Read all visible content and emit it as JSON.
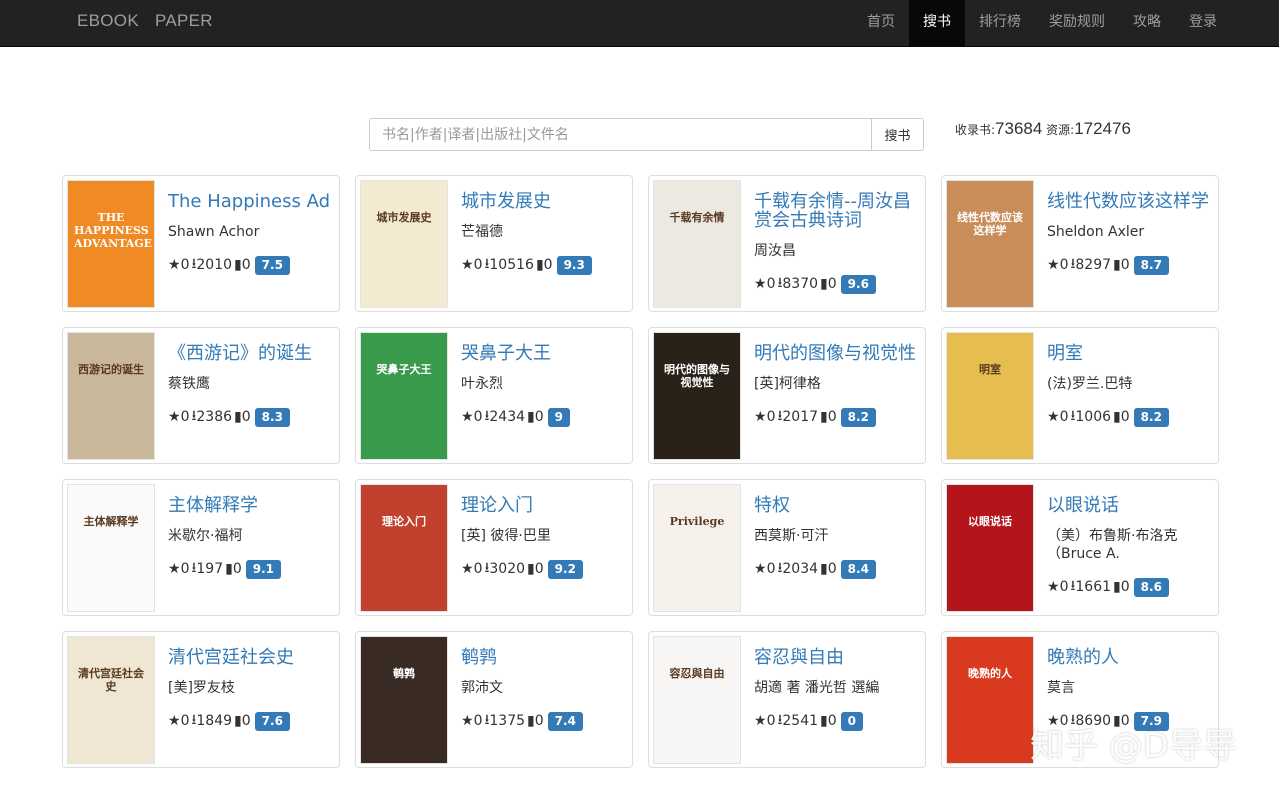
{
  "brand": {
    "word1": "EBOOK",
    "word2": "PAPER"
  },
  "nav": [
    {
      "label": "首页",
      "active": false
    },
    {
      "label": "搜书",
      "active": true
    },
    {
      "label": "排行榜",
      "active": false
    },
    {
      "label": "奖励规则",
      "active": false
    },
    {
      "label": "攻略",
      "active": false
    },
    {
      "label": "登录",
      "active": false
    }
  ],
  "search": {
    "placeholder": "书名|作者|译者|出版社|文件名",
    "value": "",
    "button": "搜书"
  },
  "stats": {
    "books_label": "收录书:",
    "books": "73684",
    "resources_label": "资源:",
    "resources": "172476"
  },
  "icons": {
    "star": "★",
    "download": "⭳",
    "comment": "▮"
  },
  "books": [
    {
      "title": "The Happiness Ad",
      "author": "Shawn Achor",
      "stars": "0",
      "downloads": "2010",
      "comments": "0",
      "score": "7.5",
      "cover_color": "#f08a24",
      "cover_text": "THE HAPPINESS ADVANTAGE"
    },
    {
      "title": "城市发展史",
      "author": "芒福德",
      "stars": "0",
      "downloads": "10516",
      "comments": "0",
      "score": "9.3",
      "cover_color": "#f3ead2",
      "cover_text": "城市发展史"
    },
    {
      "title": "千载有余情--周汝昌赏会古典诗词",
      "author": "周汝昌",
      "stars": "0",
      "downloads": "8370",
      "comments": "0",
      "score": "9.6",
      "cover_color": "#ece9e1",
      "cover_text": "千载有余情"
    },
    {
      "title": "线性代数应该这样学",
      "author": "Sheldon Axler",
      "stars": "0",
      "downloads": "8297",
      "comments": "0",
      "score": "8.7",
      "cover_color": "#c98d5a",
      "cover_text": "线性代数应该这样学"
    },
    {
      "title": "《西游记》的诞生",
      "author": "蔡铁鹰",
      "stars": "0",
      "downloads": "2386",
      "comments": "0",
      "score": "8.3",
      "cover_color": "#c9b79a",
      "cover_text": "西游记的诞生"
    },
    {
      "title": "哭鼻子大王",
      "author": "叶永烈",
      "stars": "0",
      "downloads": "2434",
      "comments": "0",
      "score": "9",
      "cover_color": "#3a9a4b",
      "cover_text": "哭鼻子大王"
    },
    {
      "title": "明代的图像与视觉性",
      "author": "[英]柯律格",
      "stars": "0",
      "downloads": "2017",
      "comments": "0",
      "score": "8.2",
      "cover_color": "#2a2119",
      "cover_text": "明代的图像与视觉性"
    },
    {
      "title": "明室",
      "author": "(法)罗兰.巴特",
      "stars": "0",
      "downloads": "1006",
      "comments": "0",
      "score": "8.2",
      "cover_color": "#e6bd4f",
      "cover_text": "明室"
    },
    {
      "title": "主体解释学",
      "author": "米歇尔·福柯",
      "stars": "0",
      "downloads": "197",
      "comments": "0",
      "score": "9.1",
      "cover_color": "#fafafa",
      "cover_text": "主体解释学"
    },
    {
      "title": "理论入门",
      "author": "[英] 彼得·巴里",
      "stars": "0",
      "downloads": "3020",
      "comments": "0",
      "score": "9.2",
      "cover_color": "#c2402e",
      "cover_text": "理论入门"
    },
    {
      "title": "特权",
      "author": "西莫斯·可汗",
      "stars": "0",
      "downloads": "2034",
      "comments": "0",
      "score": "8.4",
      "cover_color": "#f6f1ea",
      "cover_text": "Privilege"
    },
    {
      "title": "以眼说话",
      "author": "（美）布鲁斯·布洛克（Bruce A.",
      "stars": "0",
      "downloads": "1661",
      "comments": "0",
      "score": "8.6",
      "cover_color": "#b3151b",
      "cover_text": "以眼说话"
    },
    {
      "title": "清代宫廷社会史",
      "author": "[美]罗友枝",
      "stars": "0",
      "downloads": "1849",
      "comments": "0",
      "score": "7.6",
      "cover_color": "#efe6d3",
      "cover_text": "清代宫廷社会史"
    },
    {
      "title": "鹌鹑",
      "author": "郭沛文",
      "stars": "0",
      "downloads": "1375",
      "comments": "0",
      "score": "7.4",
      "cover_color": "#3a2a24",
      "cover_text": "鹌鹑"
    },
    {
      "title": "容忍與自由",
      "author": "胡適 著 潘光哲 選編",
      "stars": "0",
      "downloads": "2541",
      "comments": "0",
      "score": "0",
      "cover_color": "#f7f6f4",
      "cover_text": "容忍與自由"
    },
    {
      "title": "晚熟的人",
      "author": "莫言",
      "stars": "0",
      "downloads": "8690",
      "comments": "0",
      "score": "7.9",
      "cover_color": "#d8391f",
      "cover_text": "晚熟的人"
    }
  ],
  "watermark": "知乎 @D导导"
}
